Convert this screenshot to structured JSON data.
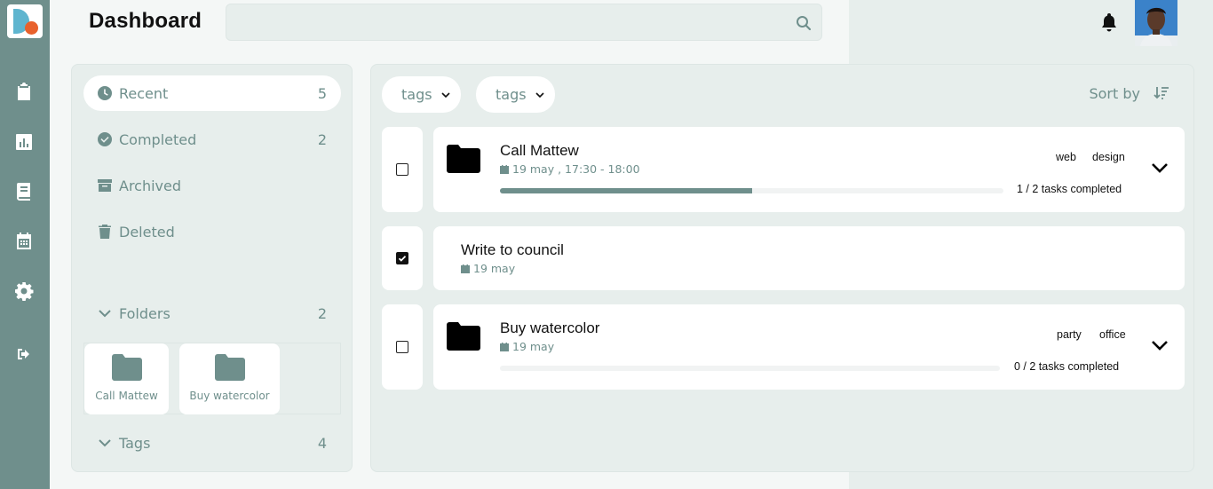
{
  "header": {
    "title": "Dashboard",
    "search_placeholder": ""
  },
  "sidebar": {
    "items": [
      {
        "icon": "clipboard-list-icon"
      },
      {
        "icon": "bar-chart-icon"
      },
      {
        "icon": "book-icon"
      },
      {
        "icon": "calendar-icon"
      },
      {
        "icon": "gear-icon"
      },
      {
        "icon": "logout-icon"
      }
    ]
  },
  "left_panel": {
    "filters": [
      {
        "label": "Recent",
        "count": "5",
        "icon": "clock-icon",
        "active": true
      },
      {
        "label": "Completed",
        "count": "2",
        "icon": "check-circle-icon"
      },
      {
        "label": "Archived",
        "count": "",
        "icon": "archive-icon"
      },
      {
        "label": "Deleted",
        "count": "",
        "icon": "trash-icon"
      }
    ],
    "folders": {
      "label": "Folders",
      "count": "2",
      "items": [
        "Call Mattew",
        "Buy watercolor"
      ]
    },
    "tags": {
      "label": "Tags",
      "count": "4"
    }
  },
  "main": {
    "tag_filters": [
      "tags",
      "tags"
    ],
    "sort_label": "Sort by",
    "tasks": [
      {
        "title": "Call Mattew",
        "date": "19 may , 17:30 - 18:00",
        "checked": false,
        "tags": [
          "web",
          "design"
        ],
        "progress": "1 / 2 tasks completed",
        "progress_fraction": 0.5
      },
      {
        "title": "Write to council",
        "date": "19 may",
        "checked": true
      },
      {
        "title": "Buy watercolor",
        "date": "19 may",
        "checked": false,
        "tags": [
          "party",
          "office"
        ],
        "progress": "0 / 2 tasks completed",
        "progress_fraction": 0
      }
    ]
  },
  "colors": {
    "accent": "#6f8f8c",
    "panel": "#e7eeec",
    "logo_blue": "#5fb5cf",
    "logo_orange": "#e8612c"
  }
}
